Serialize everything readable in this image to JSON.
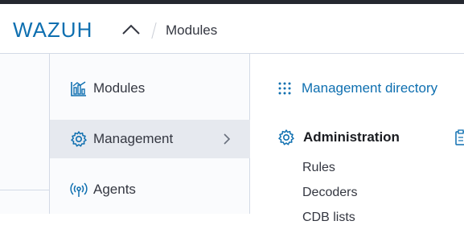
{
  "header": {
    "logo_text": "WAZUH",
    "breadcrumb": "Modules"
  },
  "menu": {
    "items": [
      {
        "label": "Modules",
        "icon": "modules-chart-icon",
        "active": false
      },
      {
        "label": "Management",
        "icon": "gear-icon",
        "active": true
      },
      {
        "label": "Agents",
        "icon": "broadcast-icon",
        "active": false
      }
    ]
  },
  "panel": {
    "directory_link": "Management directory",
    "section_title": "Administration",
    "sub_items": [
      "Rules",
      "Decoders",
      "CDB lists"
    ]
  },
  "colors": {
    "brand": "#0e6fb0",
    "active_bg": "#e6e9ef",
    "menu_bg": "#fafbfd",
    "top_strip": "#25282f"
  }
}
